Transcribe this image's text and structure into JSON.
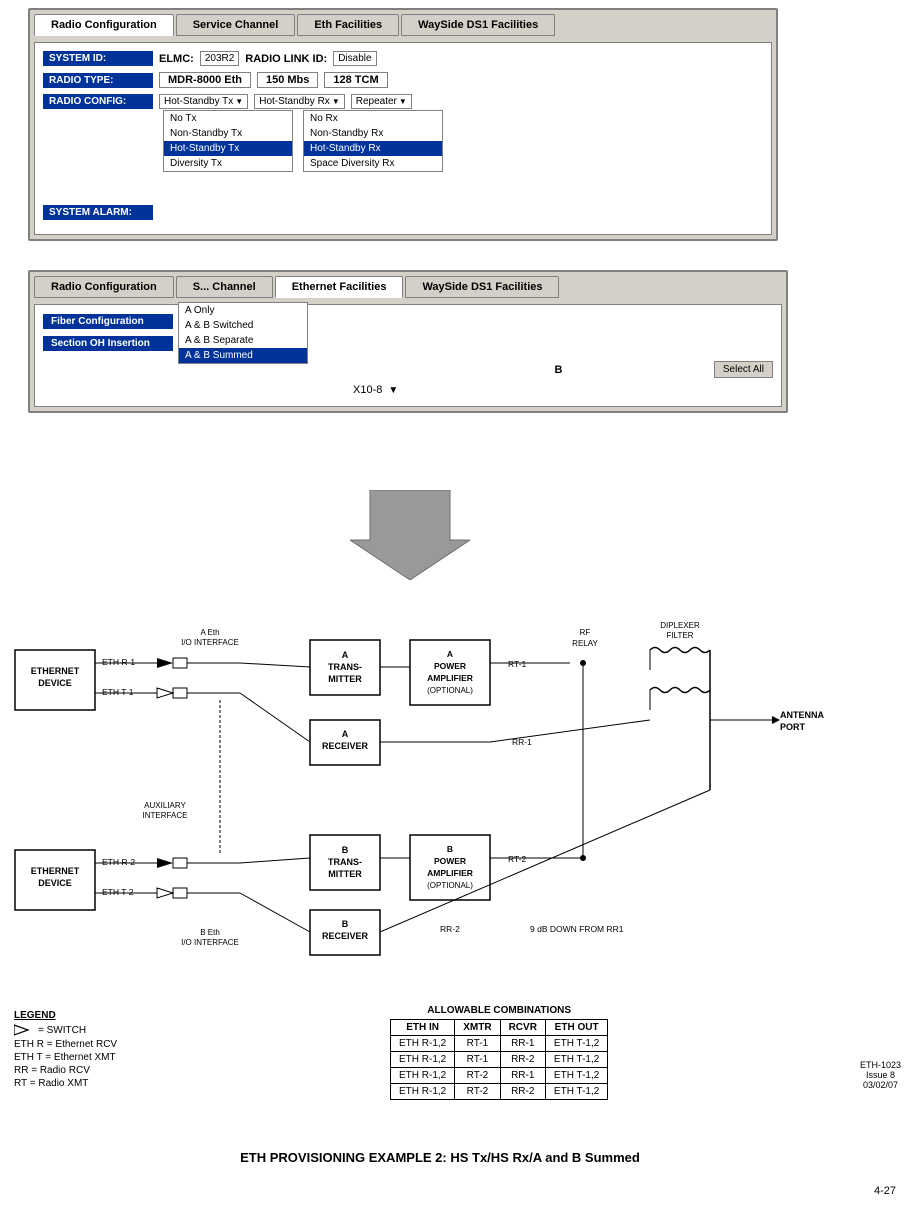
{
  "tabs_top": {
    "tab1": "Radio Configuration",
    "tab2": "Service Channel",
    "tab3": "Eth Facilities",
    "tab4": "WaySide DS1 Facilities"
  },
  "tabs_second": {
    "tab1": "Radio Configuration",
    "tab2": "Service Channel",
    "tab3": "Ethernet Facilities",
    "tab4": "WaySide DS1 Facilities"
  },
  "system_id_label": "SYSTEM ID:",
  "elmc_label": "ELMC:",
  "elmc_val": "203R2",
  "radio_link_label": "RADIO LINK ID:",
  "radio_link_val": "Disable",
  "radio_type_label": "RADIO TYPE:",
  "radio_type_val": "MDR-8000 Eth",
  "mbs_val": "150 Mbs",
  "tcm_val": "128 TCM",
  "radio_config_label": "RADIO CONFIG:",
  "hot_standby_tx": "Hot-Standby Tx",
  "hot_standby_rx": "Hot-Standby Rx",
  "repeater": "Repeater",
  "dropdown_tx_items": [
    "No Tx",
    "Non-Standby Tx",
    "Hot-Standby Tx",
    "Diversity Tx"
  ],
  "dropdown_rx_items": [
    "No Rx",
    "Non-Standby Rx",
    "Hot-Standby Rx",
    "Space Diversity Rx"
  ],
  "system_alarm_label": "SYSTEM ALARM:",
  "fiber_config_label": "Fiber Configuration",
  "fiber_config_val": "A & B Summed",
  "fiber_dropdown_items": [
    "A Only",
    "A & B Switched",
    "A & B Separate",
    "A & B Summed"
  ],
  "section_oh_label": "Section OH Insertion",
  "receiver_label": "RECEIVER",
  "b_label": "B",
  "select_all": "Select All",
  "x10_8": "X10-8",
  "legend": {
    "title": "LEGEND",
    "switch_label": "=  SWITCH",
    "eth_r_label": "ETH R =  Ethernet RCV",
    "eth_t_label": "ETH T =  Ethernet XMT",
    "rr_label": "RR      =  Radio RCV",
    "rt_label": "RT      =  Radio XMT"
  },
  "diagram": {
    "ethernet_device_1": "ETHERNET\nDEVICE",
    "ethernet_device_2": "ETHERNET\nDEVICE",
    "eth_r1": "ETH R-1",
    "eth_t1": "ETH T-1",
    "eth_r2": "ETH R-2",
    "eth_t2": "ETH T-2",
    "a_eth_interface": "A Eth\nI/O INTERFACE",
    "b_eth_interface": "B Eth\nI/O INTERFACE",
    "auxiliary_interface": "AUXILIARY\nINTERFACE",
    "a_transmitter": "A\nTRANS-\nMITTER",
    "a_receiver": "A\nRECEIVER",
    "b_transmitter": "B\nTRANS-\nMITTER",
    "b_receiver": "B\nRECEIVER",
    "a_power_amp": "A\nPOWER\nAMPLIFIER\n(OPTIONAL)",
    "b_power_amp": "B\nPOWER\nAMPLIFIER\n(OPTIONAL)",
    "rf_relay": "RF\nRELAY",
    "diplexer_filter": "DIPLEXER\nFILTER",
    "antenna_port": "ANTENNA\nPORT",
    "rt1": "RT-1",
    "rt2": "RT-2",
    "rr1": "RR-1",
    "rr2": "RR-2",
    "rr2_note": "9 dB DOWN FROM RR1"
  },
  "allowable": {
    "title": "ALLOWABLE COMBINATIONS",
    "headers": [
      "ETH IN",
      "XMTR",
      "RCVR",
      "ETH OUT"
    ],
    "rows": [
      [
        "ETH R-1,2",
        "RT-1",
        "RR-1",
        "ETH T-1,2"
      ],
      [
        "ETH R-1,2",
        "RT-1",
        "RR-2",
        "ETH T-1,2"
      ],
      [
        "ETH R-1,2",
        "RT-2",
        "RR-1",
        "ETH T-1,2"
      ],
      [
        "ETH R-1,2",
        "RT-2",
        "RR-2",
        "ETH T-1,2"
      ]
    ]
  },
  "eth_num_label": "ETH-1023\nIssue 8\n03/02/07",
  "bottom_title": "ETH PROVISIONING EXAMPLE 2:  HS Tx/HS Rx/A and B Summed",
  "page_num": "4-27"
}
